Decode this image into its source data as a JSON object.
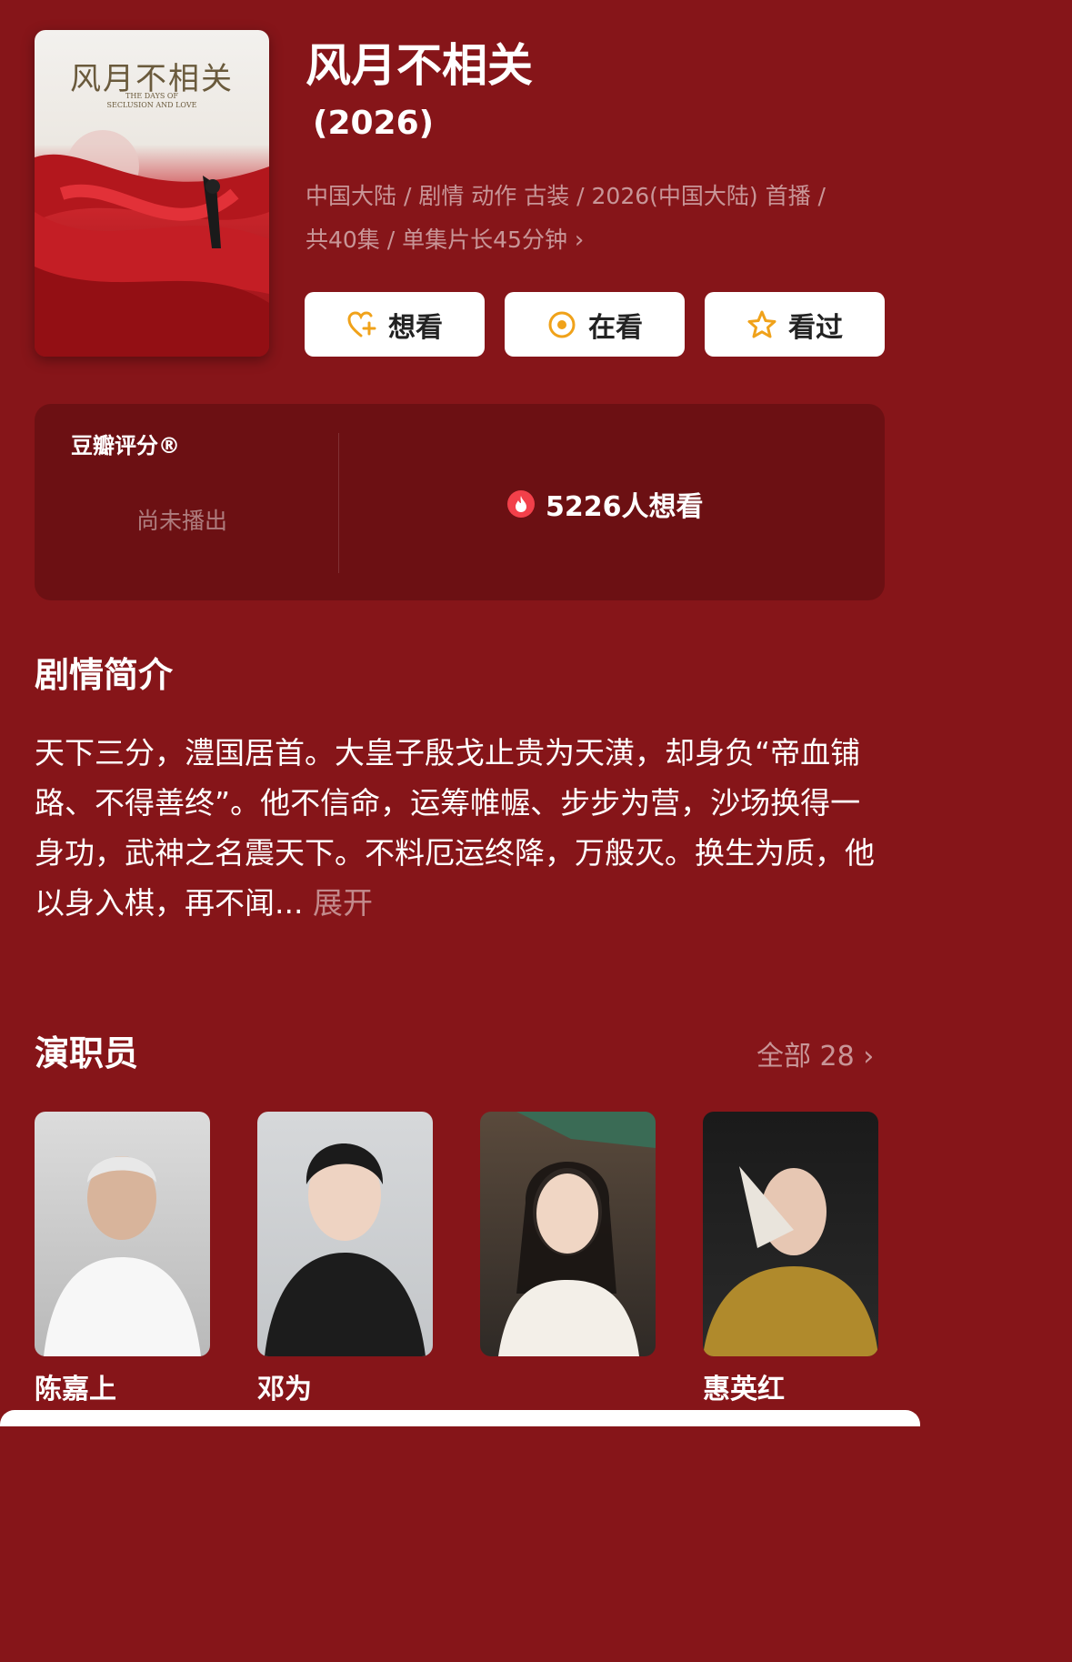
{
  "poster": {
    "title_art": "风月不相关",
    "subtitle_art": "THE DAYS OF\nSECLUSION AND LOVE"
  },
  "header": {
    "title": "风月不相关",
    "year": "(2026)",
    "meta_line1": "中国大陆 / 剧情 动作 古装 / 2026(中国大陆) 首播 /",
    "meta_line2": "共40集 / 单集片长45分钟",
    "meta_chevron": "›"
  },
  "actions": [
    {
      "label": "想看",
      "icon": "heart-plus-icon"
    },
    {
      "label": "在看",
      "icon": "target-icon"
    },
    {
      "label": "看过",
      "icon": "star-icon"
    }
  ],
  "rating": {
    "label": "豆瓣评分®",
    "status": "尚未播出",
    "wish_count_text": "5226人想看"
  },
  "synopsis": {
    "heading": "剧情简介",
    "text": "天下三分，澧国居首。大皇子殷戈止贵为天潢，却身负“帝血铺路、不得善终”。他不信命，运筹帷幄、步步为营，沙场换得一身功，武神之名震天下。不料厄运终降，万般灭。换生为质，他以身入棋，再不闻...",
    "expand": "展开"
  },
  "cast": {
    "heading": "演职员",
    "all_label": "全部 28",
    "all_chevron": "›",
    "members": [
      {
        "name": "陈嘉上"
      },
      {
        "name": "邓为"
      },
      {
        "name": ""
      },
      {
        "name": "惠英红"
      }
    ]
  },
  "colors": {
    "background": "#861519",
    "card": "#6c1013",
    "accent_orange": "#f0a21a",
    "fire": "#f2404a"
  }
}
